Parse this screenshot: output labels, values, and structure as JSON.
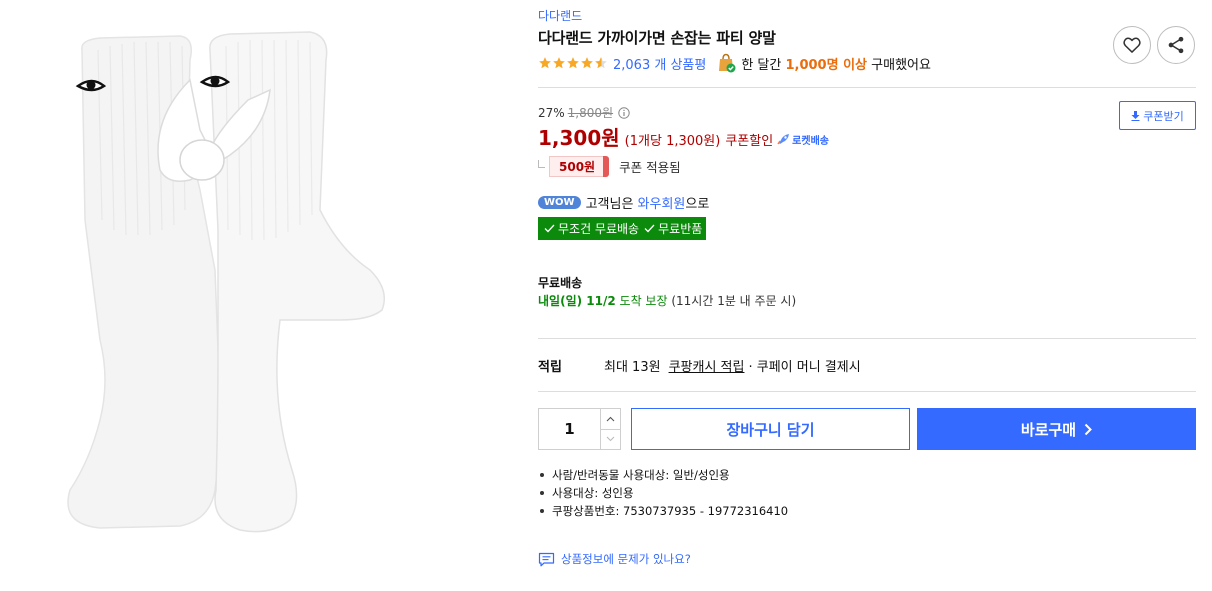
{
  "product": {
    "brand": "다다랜드",
    "title": "다다랜드 가까이가면 손잡는 파티 양말",
    "image_alt": "white socks with eyes holding hands"
  },
  "rating": {
    "stars": 4.5,
    "review_count": "2,063 개 상품평",
    "sold_prefix": "한 달간",
    "sold_amount": "1,000명 이상",
    "sold_suffix": "구매했어요"
  },
  "price": {
    "discount_rate": "27%",
    "original_price": "1,800원",
    "final_price": "1,300원",
    "unit_price": "(1개당 1,300원)",
    "coupon_discount_label": "쿠폰할인",
    "rocket_label": "로켓배송",
    "coupon_amount": "500원",
    "coupon_applied_label": "쿠폰 적용됨",
    "coupon_button_label": "쿠폰받기"
  },
  "wow": {
    "badge": "WOW",
    "prefix": "고객님은",
    "link": "와우회원",
    "suffix": "으로",
    "benefits": [
      "무조건 무료배송",
      "무료반품"
    ]
  },
  "shipping": {
    "label": "무료배송",
    "arrival_day": "내일(일) 11/2",
    "arrival_text": "도착 보장",
    "note": "(11시간 1분 내 주문 시)"
  },
  "points": {
    "label": "적립",
    "max": "최대 13원",
    "link": "쿠팡캐시 적립",
    "rest": "· 쿠페이 머니 결제시"
  },
  "purchase": {
    "quantity": "1",
    "cart_label": "장바구니 담기",
    "buy_label": "바로구매"
  },
  "specs": [
    "사람/반려동물 사용대상: 일반/성인용",
    "사용대상: 성인용",
    "쿠팡상품번호: 7530737935 - 19772316410"
  ],
  "report": {
    "label": "상품정보에 문제가 있나요?"
  },
  "colors": {
    "accent_blue": "#346aff",
    "price_red": "#ae0000",
    "wow_green": "#0c8a0c",
    "sold_orange": "#e96d0c"
  }
}
